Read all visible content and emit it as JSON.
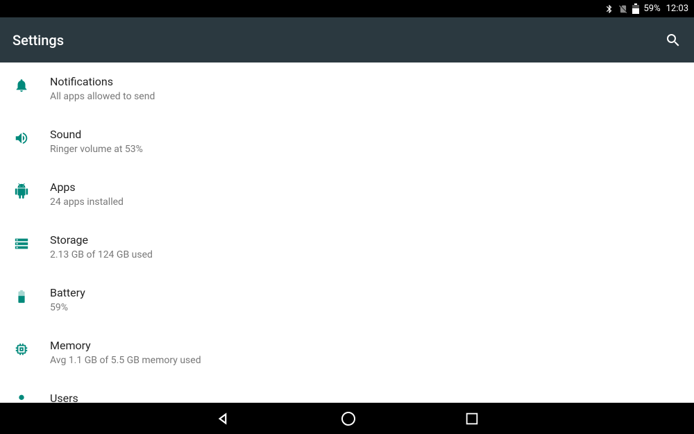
{
  "status_bar": {
    "battery_pct": "59%",
    "time": "12:03"
  },
  "app_bar": {
    "title": "Settings"
  },
  "settings": [
    {
      "icon": "bell",
      "title": "Notifications",
      "sub": "All apps allowed to send"
    },
    {
      "icon": "volume",
      "title": "Sound",
      "sub": "Ringer volume at 53%"
    },
    {
      "icon": "android",
      "title": "Apps",
      "sub": "24 apps installed"
    },
    {
      "icon": "storage",
      "title": "Storage",
      "sub": "2.13 GB of 124 GB used"
    },
    {
      "icon": "battery",
      "title": "Battery",
      "sub": "59%"
    },
    {
      "icon": "memory",
      "title": "Memory",
      "sub": "Avg 1.1 GB of 5.5 GB memory used"
    },
    {
      "icon": "user",
      "title": "Users",
      "sub": ""
    }
  ],
  "colors": {
    "accent": "#00897b",
    "appbar": "#2b3940"
  }
}
